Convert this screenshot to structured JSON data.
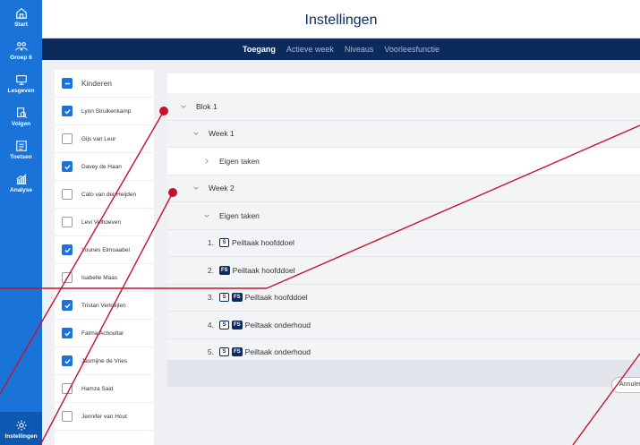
{
  "nav": {
    "items": [
      {
        "label": "Start",
        "icon": "home-icon"
      },
      {
        "label": "Groep 6",
        "icon": "group-icon"
      },
      {
        "label": "Lesgeven",
        "icon": "teach-icon"
      },
      {
        "label": "Volgen",
        "icon": "follow-icon"
      },
      {
        "label": "Toetsen",
        "icon": "test-icon"
      },
      {
        "label": "Analyse",
        "icon": "analysis-icon"
      }
    ],
    "bottom": {
      "label": "Instellingen",
      "icon": "gear-icon"
    }
  },
  "header": {
    "title": "Instellingen"
  },
  "tabs": [
    {
      "label": "Toegang",
      "active": true
    },
    {
      "label": "Actieve week",
      "active": false
    },
    {
      "label": "Niveaus",
      "active": false
    },
    {
      "label": "Voorleesfunctie",
      "active": false
    }
  ],
  "children": {
    "header_label": "Kinderen",
    "list": [
      {
        "name": "Lynn Struikenkamp",
        "checked": true
      },
      {
        "name": "Gijs van Leur",
        "checked": false
      },
      {
        "name": "Davey de Haan",
        "checked": true
      },
      {
        "name": "Cato van der Heijden",
        "checked": false
      },
      {
        "name": "Levi Velhoeven",
        "checked": false
      },
      {
        "name": "Younes Elmoaabel",
        "checked": true
      },
      {
        "name": "Isabelle Maas",
        "checked": false
      },
      {
        "name": "Tristan Verkuijlen",
        "checked": true
      },
      {
        "name": "Fatma Achoultar",
        "checked": true
      },
      {
        "name": "Jasmijne de Vries",
        "checked": true
      },
      {
        "name": "Hamza Said",
        "checked": false
      },
      {
        "name": "Jennifer van Hout",
        "checked": false
      }
    ]
  },
  "tree": {
    "blok": "Blok 1",
    "week1": "Week 1",
    "week1_eigen": "Eigen taken",
    "week2": "Week 2",
    "week2_eigen": "Eigen taken",
    "tasks": [
      {
        "num": "1.",
        "badges": [
          "S"
        ],
        "label": "Peiltaak hoofddoel"
      },
      {
        "num": "2.",
        "badges": [
          "FS"
        ],
        "label": "Peiltaak hoofddoel"
      },
      {
        "num": "3.",
        "badges": [
          "S",
          "FS"
        ],
        "label": "Peiltaak hoofddoel"
      },
      {
        "num": "4.",
        "badges": [
          "S",
          "FS"
        ],
        "label": "Peiltaak onderhoud"
      },
      {
        "num": "5.",
        "badges": [
          "S",
          "FS"
        ],
        "label": "Peiltaak onderhoud"
      }
    ]
  },
  "footer": {
    "cancel_label": "Annuleren"
  },
  "colors": {
    "nav": "#1a73d9",
    "navy": "#0c2a5c",
    "annotation": "#c8102e"
  }
}
